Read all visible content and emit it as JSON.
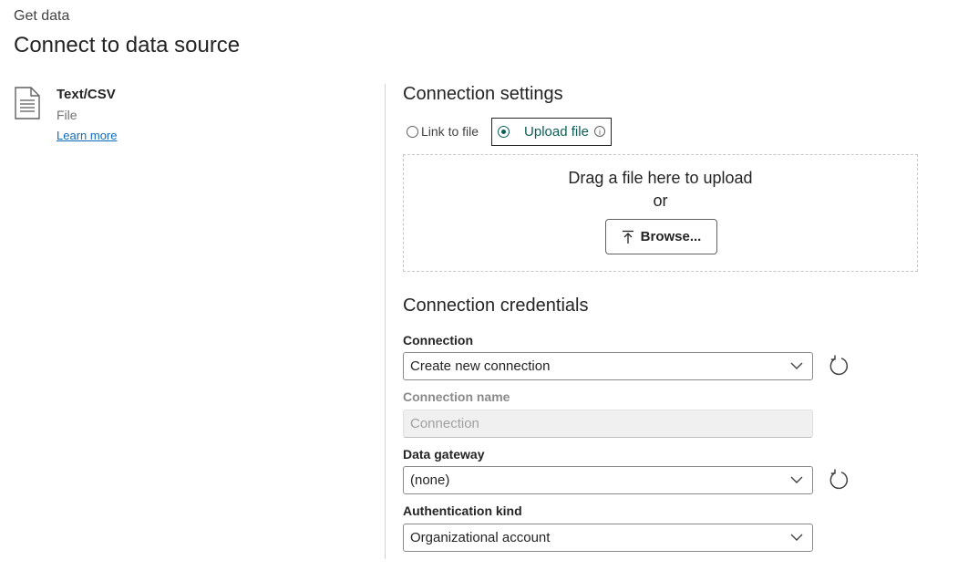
{
  "header": {
    "breadcrumb": "Get data",
    "title": "Connect to data source"
  },
  "source": {
    "icon": "document-icon",
    "name": "Text/CSV",
    "type": "File",
    "learn_more": "Learn more"
  },
  "connection_settings": {
    "heading": "Connection settings",
    "options": [
      {
        "label": "Link to file",
        "selected": false
      },
      {
        "label": "Upload file",
        "selected": true
      }
    ],
    "dropzone": {
      "line1": "Drag a file here to upload",
      "line2": "or",
      "browse_label": "Browse..."
    }
  },
  "connection_credentials": {
    "heading": "Connection credentials",
    "connection": {
      "label": "Connection",
      "value": "Create new connection"
    },
    "connection_name": {
      "label": "Connection name",
      "placeholder": "Connection"
    },
    "data_gateway": {
      "label": "Data gateway",
      "value": "(none)"
    },
    "authentication_kind": {
      "label": "Authentication kind",
      "value": "Organizational account"
    }
  },
  "colors": {
    "accent": "#0e5e57",
    "link": "#0f6cbd",
    "divider": "#d1d1d1"
  }
}
